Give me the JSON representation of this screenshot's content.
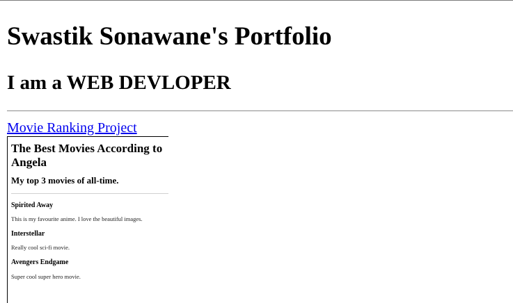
{
  "header": {
    "title": "Swastik Sonawane's Portfolio",
    "subtitle": "I am a WEB DEVLOPER"
  },
  "project_link": {
    "label": "Movie Ranking Project"
  },
  "embedded_page": {
    "title": "The Best Movies According to Angela",
    "subtitle": "My top 3 movies of all-time.",
    "movies": [
      {
        "name": "Spirited Away",
        "description": "This is my favourite anime. I love the beautiful images."
      },
      {
        "name": "Interstellar",
        "description": "Really cool sci-fi movie."
      },
      {
        "name": "Avengers Endgame",
        "description": "Super cool super hero movie."
      }
    ]
  },
  "colors": {
    "link": "#0000ee",
    "divider": "#8a8a8a"
  }
}
